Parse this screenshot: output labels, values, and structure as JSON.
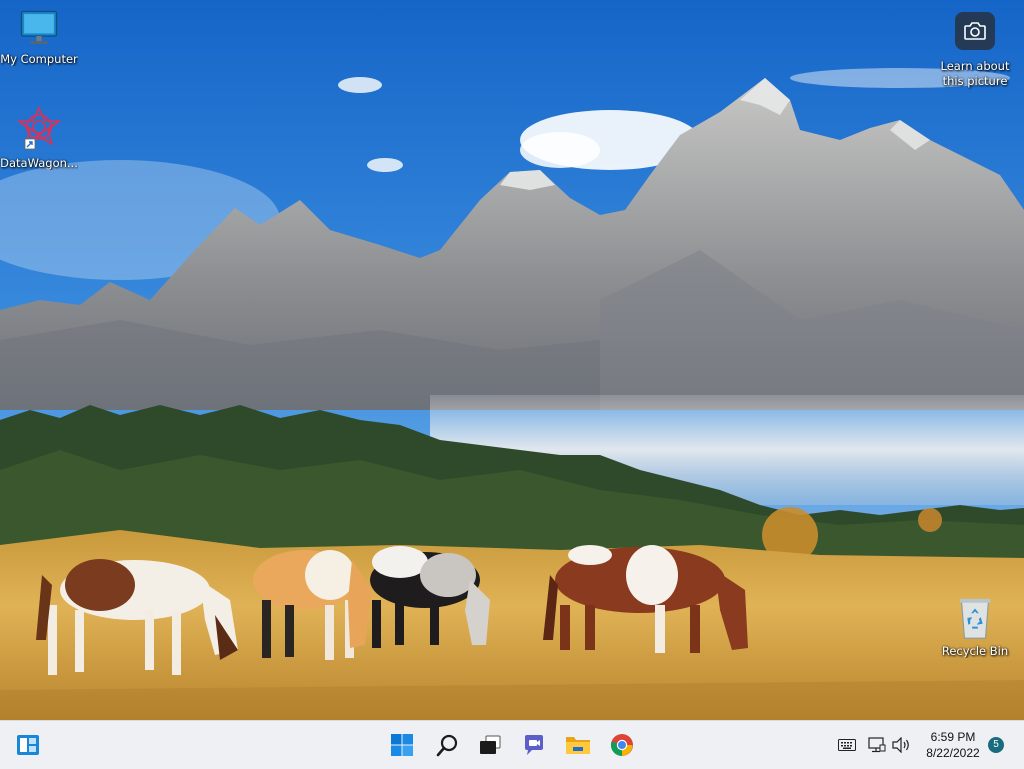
{
  "desktop": {
    "icons": [
      {
        "label": "My Computer",
        "icon": "monitor-icon"
      },
      {
        "label": "DataWagon...",
        "icon": "datawagon-app-icon"
      },
      {
        "label": "Recycle Bin",
        "icon": "recycle-bin-icon"
      }
    ],
    "learn_about_picture": {
      "line1": "Learn about",
      "line2": "this picture",
      "icon": "camera-icon"
    }
  },
  "taskbar": {
    "widgets_icon": "widgets-icon",
    "pinned": [
      {
        "name": "start",
        "icon": "windows-logo-icon"
      },
      {
        "name": "search",
        "icon": "search-icon"
      },
      {
        "name": "task-view",
        "icon": "task-view-icon"
      },
      {
        "name": "chat",
        "icon": "chat-icon"
      },
      {
        "name": "file-explorer",
        "icon": "folder-icon"
      },
      {
        "name": "chrome",
        "icon": "chrome-icon"
      }
    ],
    "tray": {
      "icons": [
        "keyboard-icon",
        "network-icon",
        "volume-icon"
      ],
      "time": "6:59 PM",
      "date": "8/22/2022",
      "notifications": "5"
    }
  },
  "colors": {
    "sky_top": "#1e6fd0",
    "sky_bottom": "#7fb6e8",
    "grass": "#d9a84a",
    "taskbar": "#eef0f4",
    "accent": "#0a78d4"
  }
}
